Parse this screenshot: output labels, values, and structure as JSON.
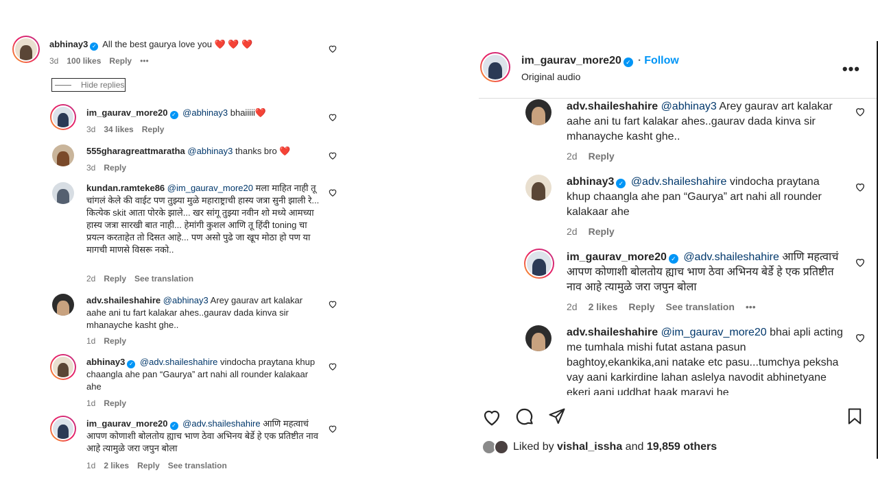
{
  "left": {
    "comments": [
      {
        "user": "abhinay3",
        "verified": true,
        "mention": "",
        "text": "All the best gaurya love you",
        "emoji": "❤️ ❤️ ❤️",
        "time": "3d",
        "likes": "100 likes",
        "reply": "Reply",
        "more": "•••"
      },
      {
        "user": "im_gaurav_more20",
        "verified": true,
        "mention": "@abhinay3",
        "text": "bhaiiiii",
        "emoji": "❤️",
        "time": "3d",
        "likes": "34 likes",
        "reply": "Reply"
      },
      {
        "user": "555gharagreattmaratha",
        "verified": false,
        "mention": "@abhinay3",
        "text": "thanks bro",
        "emoji": "❤️",
        "time": "3d",
        "reply": "Reply"
      },
      {
        "user": "kundan.ramteke86",
        "verified": false,
        "mention": "@im_gaurav_more20",
        "text": "मला माहित नाही तू चांगलं केले की वाईट पण तुझ्या मुळे महाराष्ट्राची हास्य जत्रा सुनी झाली रे... कित्येक skit आता पोरके झाले... खर सांगू तुझ्या नवीन शो मध्ये आमच्या हास्य जत्रा सारखी बात नाही... हेमांगी कुशल आणि तू हिंदी toning चा प्रयत्न करताहेत तो दिसत आहे... पण असो पुढे जा खूप मोठा हो पण या मागची माणसे विसरू नको..",
        "time": "2d",
        "reply": "Reply",
        "translate": "See translation"
      },
      {
        "user": "adv.shaileshahire",
        "verified": false,
        "mention": "@abhinay3",
        "text": "Arey gaurav art kalakar aahe ani tu fart kalakar ahes..gaurav dada kinva sir mhanayche kasht ghe..",
        "time": "1d",
        "reply": "Reply"
      },
      {
        "user": "abhinay3",
        "verified": true,
        "mention": "@adv.shaileshahire",
        "text": "vindocha praytana khup chaangla ahe pan “Gaurya” art nahi all rounder kalakaar ahe",
        "time": "1d",
        "reply": "Reply"
      },
      {
        "user": "im_gaurav_more20",
        "verified": true,
        "mention": "@adv.shaileshahire",
        "text": "आणि महत्वाचं आपण कोणाशी बोलतोय ह्याच भाण ठेवा अभिनय बेर्डे हे एक प्रतिष्टीत नाव आहे त्यामुळे जरा जपुन बोला",
        "time": "1d",
        "likes": "2 likes",
        "reply": "Reply",
        "translate": "See translation"
      }
    ],
    "hide_replies": "Hide replies"
  },
  "right": {
    "header": {
      "username": "im_gaurav_more20",
      "separator": "·",
      "follow": "Follow",
      "subtitle": "Original audio",
      "more": "•••"
    },
    "comments": [
      {
        "user": "adv.shaileshahire",
        "verified": false,
        "mention": "@abhinay3",
        "text": "Arey gaurav art kalakar aahe ani tu fart kalakar ahes..gaurav dada kinva sir mhanayche kasht ghe..",
        "time": "2d",
        "reply": "Reply"
      },
      {
        "user": "abhinay3",
        "verified": true,
        "mention": "@adv.shaileshahire",
        "text": "vindocha praytana khup chaangla ahe pan “Gaurya” art nahi all rounder kalakaar ahe",
        "time": "2d",
        "reply": "Reply"
      },
      {
        "user": "im_gaurav_more20",
        "verified": true,
        "mention": "@adv.shaileshahire",
        "text": "आणि महत्वाचं आपण कोणाशी बोलतोय ह्याच भाण ठेवा अभिनय बेर्डे हे एक प्रतिष्टीत नाव आहे त्यामुळे जरा जपुन बोला",
        "time": "2d",
        "likes": "2 likes",
        "reply": "Reply",
        "translate": "See translation",
        "more": "•••"
      },
      {
        "user": "adv.shaileshahire",
        "verified": false,
        "mention": "@im_gaurav_more20",
        "text": "bhai apli acting me tumhala mishi futat astana pasun baghtoy,ekankika,ani natake etc pasu...tumchya peksha vay aani karkirdine lahan aslelya navodit abhinetyane ekeri aani uddhat haak maravi he",
        "time": "",
        "reply": ""
      }
    ],
    "liked_by": {
      "prefix": "Liked by",
      "user": "vishal_issha",
      "middle": "and",
      "count": "19,859 others"
    }
  },
  "icons": {
    "like": "heart-outline-icon",
    "comment": "comment-icon",
    "share": "send-icon",
    "save": "bookmark-icon",
    "verified": "verified-badge-icon"
  },
  "colors": {
    "link": "#00376b",
    "follow": "#0095f6",
    "verified": "#0095f6",
    "muted": "#737373",
    "heart": "#e0245e"
  }
}
